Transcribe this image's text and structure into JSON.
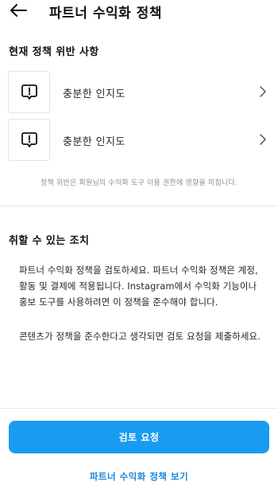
{
  "header": {
    "title": "파트너 수익화 정책",
    "back_icon": "arrow-left-icon"
  },
  "violations": {
    "heading": "현재 정책 위반 사항",
    "items": [
      {
        "label": "충분한 인지도",
        "icon": "alert-message-icon"
      },
      {
        "label": "충분한 인지도",
        "icon": "alert-message-icon"
      }
    ],
    "notice": "정책 위반은 회원님의 수익화 도구 이용 권한에 영향을 미칩니다."
  },
  "actions": {
    "heading": "취할 수 있는 조치",
    "paragraph1_lines": [
      "파트너 수익화 정책을 검토하세요. 파트너 수익화 정책은 계정,",
      "활동 및 결제에 적용됩니다. Instagram에서 수익화 기능이나",
      "홍보 도구를 사용하려면 이 정책을 준수해야 합니다."
    ],
    "paragraph2": "콘텐츠가 정책을 준수한다고 생각되면 검토 요청을 제출하세요."
  },
  "footer": {
    "primary_button": "검토 요청",
    "secondary_link": "파트너 수익화 정책 보기"
  },
  "colors": {
    "accent": "#1a9bf2",
    "link": "#1a86d9",
    "muted": "#8e8e8e"
  }
}
